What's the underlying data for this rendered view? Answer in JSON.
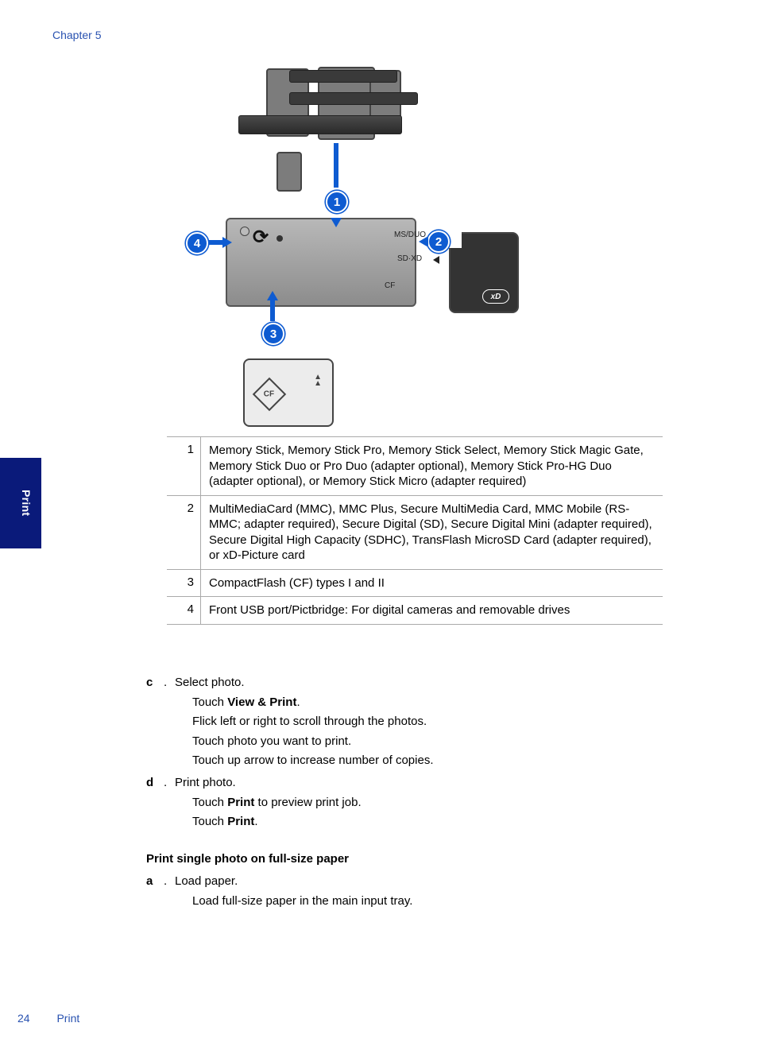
{
  "header": {
    "chapter_label": "Chapter 5"
  },
  "sidebar": {
    "tab_label": "Print"
  },
  "figure": {
    "callouts": {
      "c1": "1",
      "c2": "2",
      "c3": "3",
      "c4": "4"
    },
    "slot_labels": {
      "msduo": "MS/DUO",
      "sdxd": "SD·XD",
      "cf": "CF"
    },
    "sd_mark": "xD",
    "cf_mark": "CF"
  },
  "table": {
    "rows": [
      {
        "n": "1",
        "text": "Memory Stick, Memory Stick Pro, Memory Stick Select, Memory Stick Magic Gate, Memory Stick Duo or Pro Duo (adapter optional), Memory Stick Pro-HG Duo (adapter optional), or Memory Stick Micro (adapter required)"
      },
      {
        "n": "2",
        "text": "MultiMediaCard (MMC), MMC Plus, Secure MultiMedia Card, MMC Mobile (RS-MMC; adapter required), Secure Digital (SD), Secure Digital Mini (adapter required), Secure Digital High Capacity (SDHC), TransFlash MicroSD Card (adapter required), or xD-Picture card"
      },
      {
        "n": "3",
        "text": "CompactFlash (CF) types I and II"
      },
      {
        "n": "4",
        "text": "Front USB port/Pictbridge: For digital cameras and removable drives"
      }
    ]
  },
  "instructions": {
    "step_c": {
      "letter": "c",
      "title": "Select photo.",
      "lines": {
        "l1_pre": "Touch ",
        "l1_bold": "View & Print",
        "l1_post": ".",
        "l2": "Flick left or right to scroll through the photos.",
        "l3": "Touch photo you want to print.",
        "l4": "Touch up arrow to increase number of copies."
      }
    },
    "step_d": {
      "letter": "d",
      "title": "Print photo.",
      "lines": {
        "l1_pre": "Touch ",
        "l1_bold": "Print",
        "l1_post": " to preview print job.",
        "l2_pre": "Touch ",
        "l2_bold": "Print",
        "l2_post": "."
      }
    },
    "section2": {
      "heading": "Print single photo on full-size paper",
      "step_a": {
        "letter": "a",
        "title": "Load paper.",
        "line1": "Load full-size paper in the main input tray."
      }
    }
  },
  "footer": {
    "page_number": "24",
    "section_name": "Print"
  }
}
